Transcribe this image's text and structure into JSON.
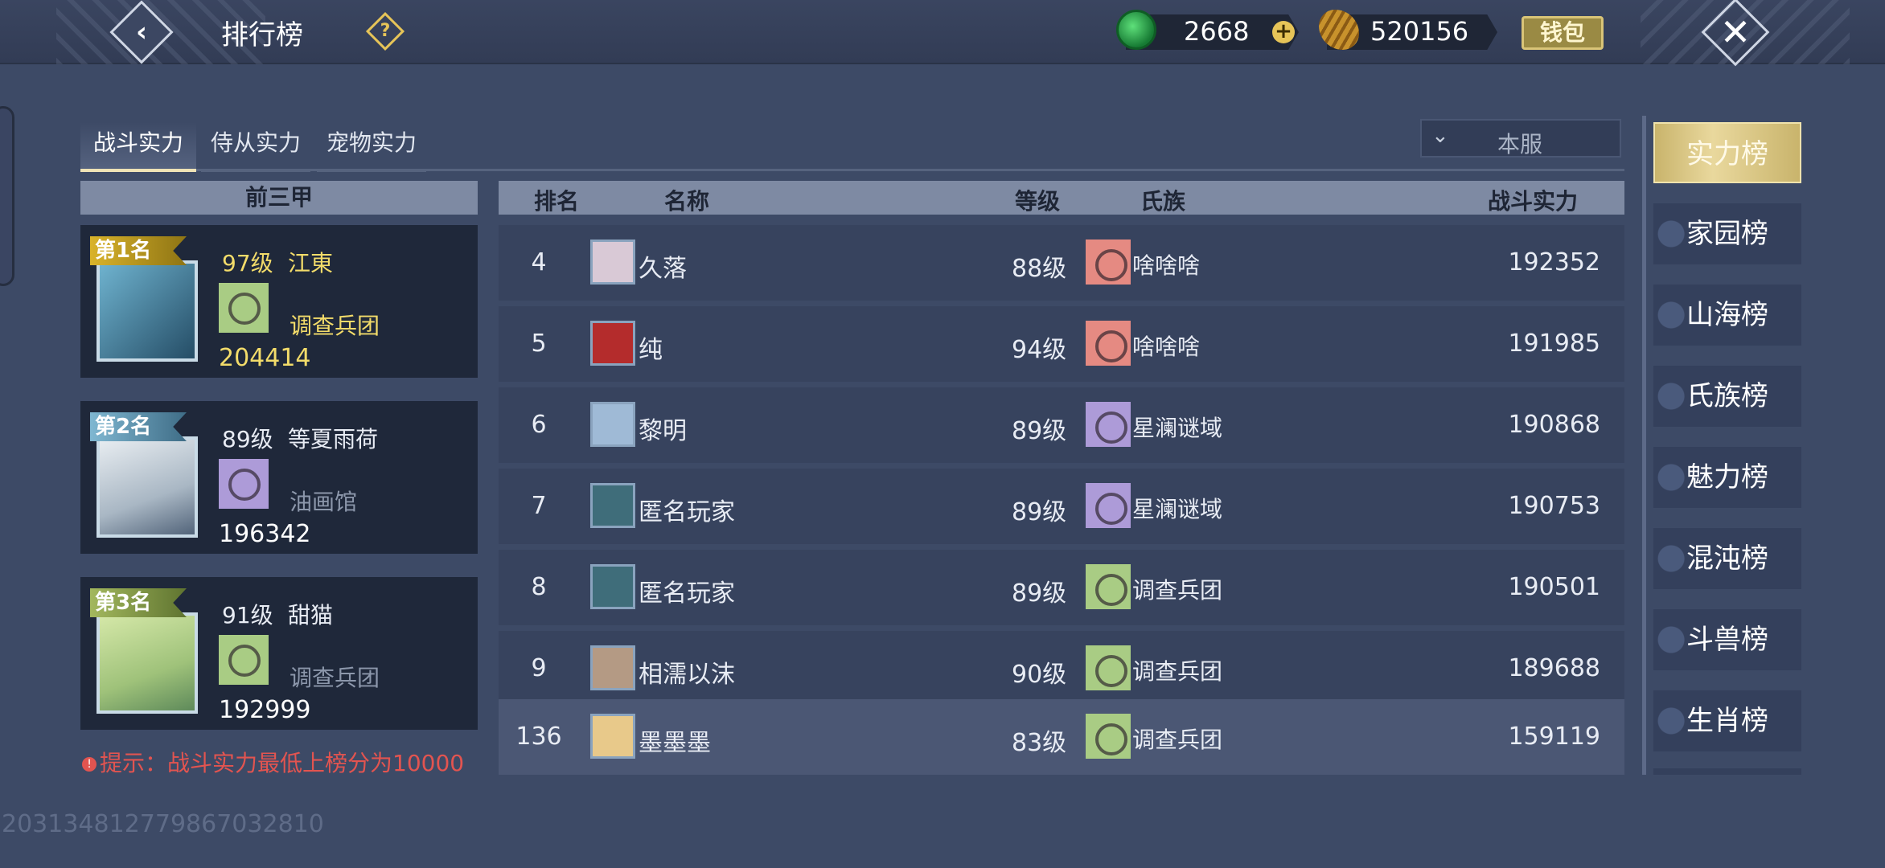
{
  "header": {
    "title": "排行榜",
    "help_icon": "?",
    "jade_amount": "2668",
    "gold_amount": "520156",
    "wallet_label": "钱包"
  },
  "tabs": [
    {
      "label": "战斗实力",
      "active": true
    },
    {
      "label": "侍从实力",
      "active": false
    },
    {
      "label": "宠物实力",
      "active": false
    }
  ],
  "server_filter": {
    "value": "本服"
  },
  "top3": {
    "header": "前三甲",
    "entries": [
      {
        "rank_label": "第1名",
        "level": "97级",
        "name": "江東",
        "guild": "调查兵团",
        "power": "204414"
      },
      {
        "rank_label": "第2名",
        "level": "89级",
        "name": "等夏雨荷",
        "guild": "油画馆",
        "power": "196342"
      },
      {
        "rank_label": "第3名",
        "level": "91级",
        "name": "甜猫",
        "guild": "调查兵团",
        "power": "192999"
      }
    ],
    "hint": "提示：战斗实力最低上榜分为10000"
  },
  "table": {
    "columns": [
      "排名",
      "名称",
      "等级",
      "氏族",
      "战斗实力"
    ],
    "rows": [
      {
        "rank": "4",
        "name": "久落",
        "level": "88级",
        "clan": "啥啥啥",
        "power": "192352"
      },
      {
        "rank": "5",
        "name": "纯",
        "level": "94级",
        "clan": "啥啥啥",
        "power": "191985"
      },
      {
        "rank": "6",
        "name": "黎明",
        "level": "89级",
        "clan": "星澜谜域",
        "power": "190868"
      },
      {
        "rank": "7",
        "name": "匿名玩家",
        "level": "89级",
        "clan": "星澜谜域",
        "power": "190753"
      },
      {
        "rank": "8",
        "name": "匿名玩家",
        "level": "89级",
        "clan": "调查兵团",
        "power": "190501"
      },
      {
        "rank": "9",
        "name": "相濡以沫",
        "level": "90级",
        "clan": "调查兵团",
        "power": "189688"
      }
    ],
    "self_row": {
      "rank": "136",
      "name": "墨墨墨",
      "level": "83级",
      "clan": "调查兵团",
      "power": "159119"
    }
  },
  "side_menu": [
    "实力榜",
    "家园榜",
    "山海榜",
    "氏族榜",
    "魅力榜",
    "混沌榜",
    "斗兽榜",
    "生肖榜"
  ],
  "uid": "20313481277986703281​0",
  "colors": {
    "accent_gold": "#e9d89d",
    "hint_red": "#e25450",
    "first_place": "#f3dc6a"
  }
}
